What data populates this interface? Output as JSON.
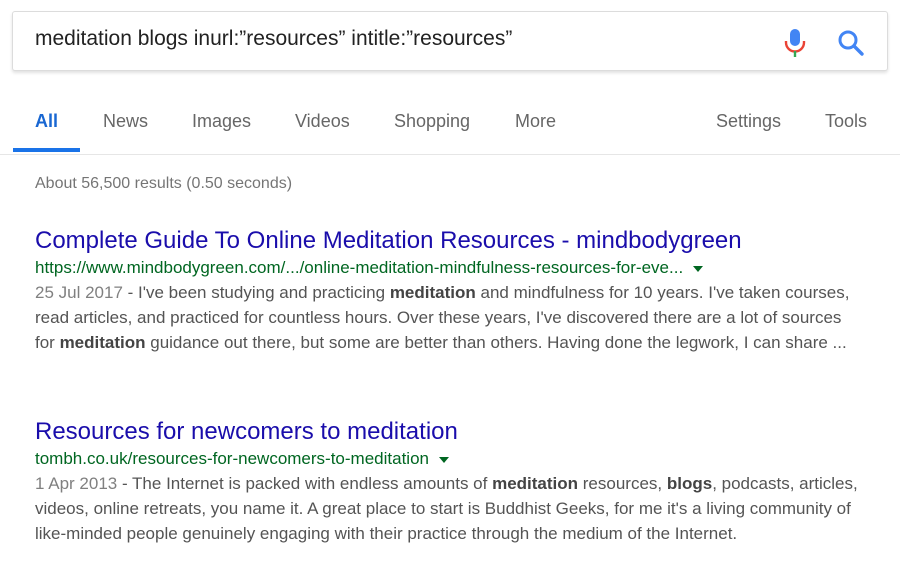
{
  "search": {
    "query": "meditation blogs inurl:”resources” intitle:”resources”"
  },
  "tabs": [
    {
      "label": "All",
      "active": true
    },
    {
      "label": "News"
    },
    {
      "label": "Images"
    },
    {
      "label": "Videos"
    },
    {
      "label": "Shopping"
    },
    {
      "label": "More"
    },
    {
      "label": "Settings"
    },
    {
      "label": "Tools"
    }
  ],
  "stats": "About 56,500 results (0.50 seconds)",
  "results": [
    {
      "title": "Complete Guide To Online Meditation Resources - mindbodygreen",
      "url": "https://www.mindbodygreen.com/.../online-meditation-mindfulness-resources-for-eve...",
      "date": "25 Jul 2017",
      "snippet_parts": [
        " - I've been studying and practicing ",
        "meditation",
        " and mindfulness for 10 years. I've taken courses, read articles, and practiced for countless hours. Over these years, I've discovered there are a lot of sources for ",
        "meditation",
        " guidance out there, but some are better than others. Having done the legwork, I can share ..."
      ]
    },
    {
      "title": "Resources for newcomers to meditation",
      "url": "tombh.co.uk/resources-for-newcomers-to-meditation",
      "date": "1 Apr 2013",
      "snippet_parts": [
        " - The Internet is packed with endless amounts of ",
        "meditation",
        " resources, ",
        "blogs",
        ", podcasts, articles, videos, online retreats, you name it. A great place to start is Buddhist Geeks, for me it's a living community of like-minded people genuinely engaging with their practice through the medium of the Internet."
      ]
    }
  ],
  "icons": {
    "mic": "microphone-icon",
    "search": "magnifier-icon",
    "caret": "triangle-down-icon"
  },
  "colors": {
    "link": "#1a0dab",
    "url": "#006621",
    "active_tab": "#1a73e8"
  }
}
